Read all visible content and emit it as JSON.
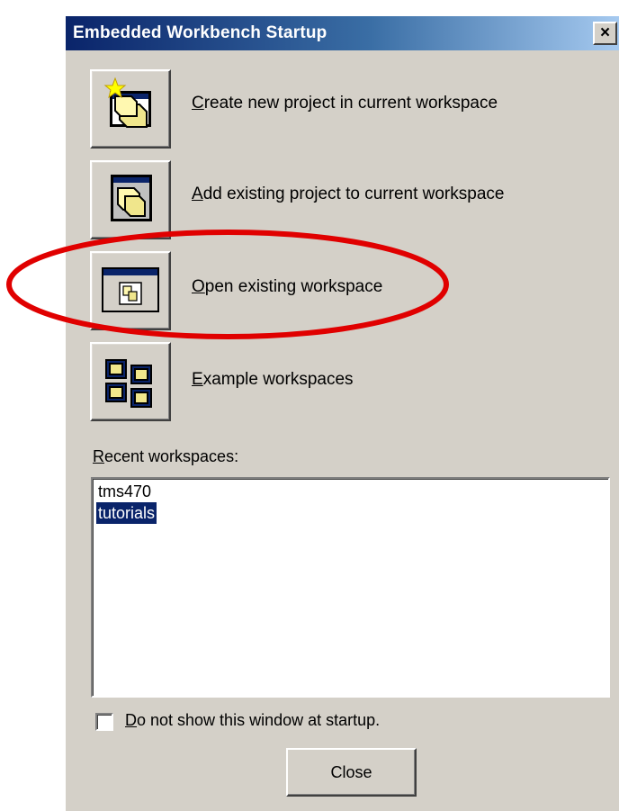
{
  "window": {
    "title": "Embedded Workbench Startup",
    "close_glyph": "×"
  },
  "actions": [
    {
      "label": "Create new project in current workspace",
      "icon": "new-project-icon"
    },
    {
      "label": "Add existing project to current workspace",
      "icon": "add-project-icon"
    },
    {
      "label": "Open existing workspace",
      "icon": "open-workspace-icon"
    },
    {
      "label": "Example workspaces",
      "icon": "example-workspaces-icon"
    }
  ],
  "recent": {
    "label": "Recent workspaces:",
    "items": [
      "tms470",
      "tutorials"
    ],
    "selected": "tutorials"
  },
  "startup_checkbox": {
    "label": "Do not show this window at startup.",
    "checked": false
  },
  "close_button": {
    "label": "Close"
  },
  "colors": {
    "dialog_bg": "#d4d0c8",
    "title_bar": "#0a246a",
    "selection": "#0a246a",
    "annotation": "#e00000"
  }
}
